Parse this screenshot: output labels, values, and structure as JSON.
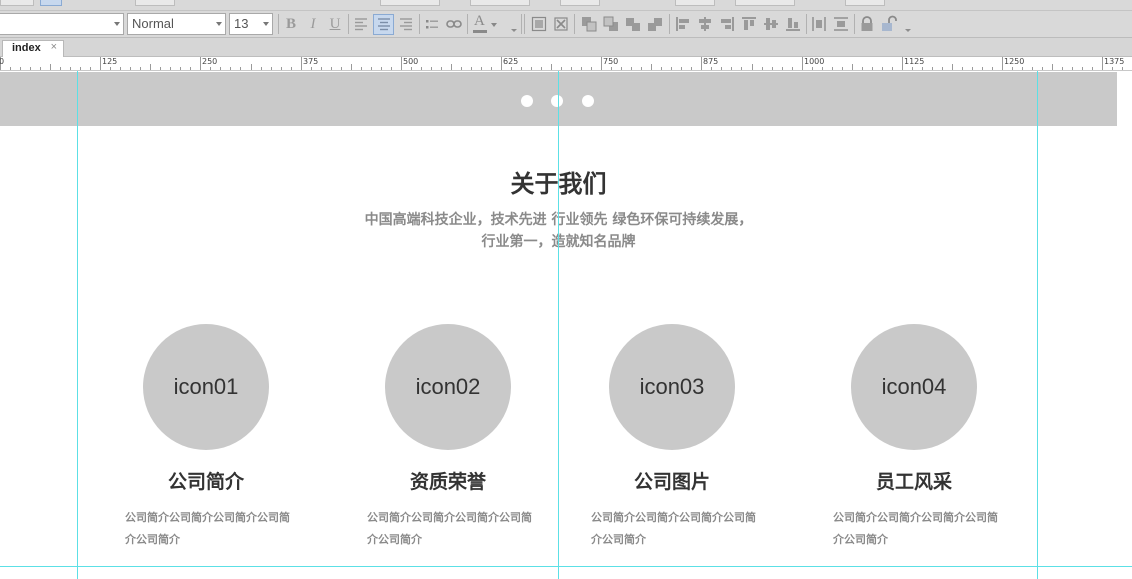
{
  "toolbar": {
    "font_family_value": "",
    "style_value": "Normal",
    "font_size_value": "13",
    "bold_glyph": "B",
    "italic_glyph": "I",
    "underline_glyph": "U",
    "font_color_glyph": "A",
    "icons": [
      "align-left-icon",
      "align-center-icon",
      "align-right-icon",
      "bullet-list-icon",
      "link-icon",
      "font-color-icon",
      "group-icon",
      "ungroup-icon",
      "bring-front-icon",
      "send-back-icon",
      "bring-forward-icon",
      "send-backward-icon",
      "align-objects-left-icon",
      "align-objects-center-icon",
      "align-objects-right-icon",
      "align-objects-top-icon",
      "align-objects-middle-icon",
      "align-objects-bottom-icon",
      "distribute-horizontal-icon",
      "distribute-vertical-icon",
      "lock-icon",
      "unlock-icon"
    ],
    "accent_color": "#8aaad3"
  },
  "tabs": [
    {
      "label": "index",
      "close_glyph": "×"
    }
  ],
  "ruler": {
    "labels": [
      "0",
      "125",
      "250",
      "375",
      "500",
      "625",
      "750",
      "875",
      "1000",
      "1125",
      "1250",
      "1375"
    ]
  },
  "page": {
    "banner_color": "#c9c9c9",
    "carousel_dots": 3,
    "about": {
      "title": "关于我们",
      "subtitle_line1": "中国高端科技企业，技术先进 行业领先 绿色环保可持续发展，",
      "subtitle_line2": "行业第一，造就知名品牌"
    },
    "features": [
      {
        "icon": "icon01",
        "title": "公司简介",
        "desc": "公司简介公司简介公司简介公司简介公司简介"
      },
      {
        "icon": "icon02",
        "title": "资质荣誉",
        "desc": "公司简介公司简介公司简介公司简介公司简介"
      },
      {
        "icon": "icon03",
        "title": "公司图片",
        "desc": "公司简介公司简介公司简介公司简介公司简介"
      },
      {
        "icon": "icon04",
        "title": "员工风采",
        "desc": "公司简介公司简介公司简介公司简介公司简介"
      }
    ]
  },
  "guides": {
    "color": "#5ce0e6"
  }
}
